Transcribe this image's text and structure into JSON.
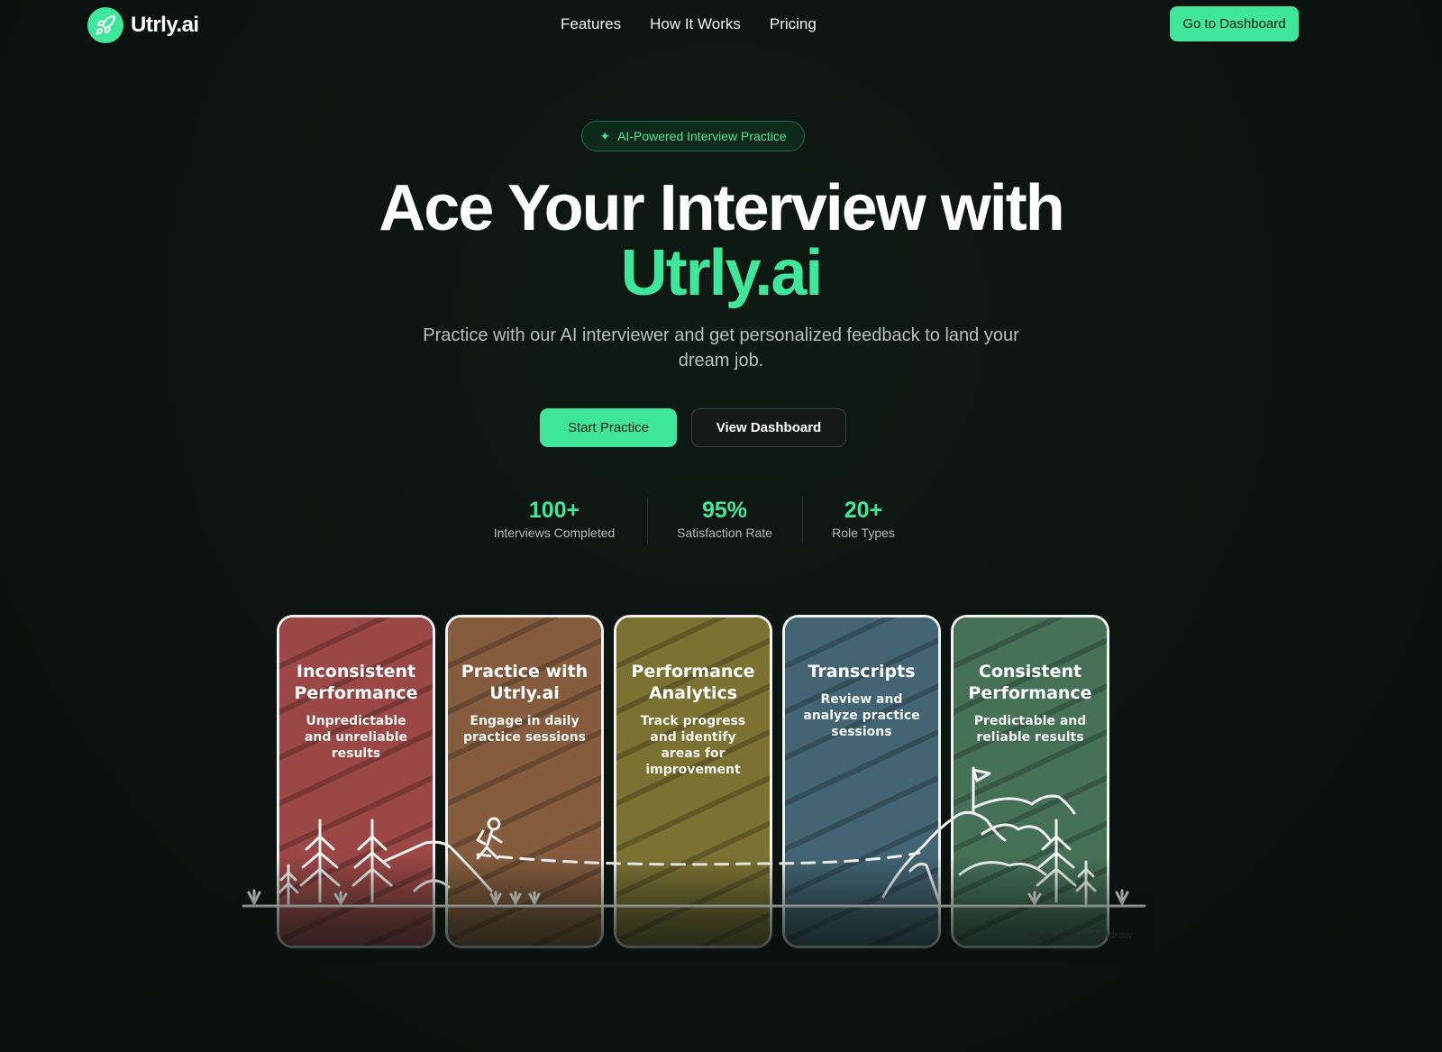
{
  "brand": {
    "name": "Utrly.ai",
    "accent": "#3fe79a"
  },
  "nav": {
    "links": [
      "Features",
      "How It Works",
      "Pricing"
    ],
    "cta_label": "Go to Dashboard"
  },
  "hero": {
    "badge": "AI-Powered Interview Practice",
    "title_line1": "Ace Your Interview with",
    "title_line2": "Utrly.ai",
    "subtitle": "Practice with our AI interviewer and get personalized feedback to land your dream job.",
    "primary_button": "Start Practice",
    "secondary_button": "View Dashboard"
  },
  "stats": [
    {
      "value": "100+",
      "label": "Interviews Completed"
    },
    {
      "value": "95%",
      "label": "Satisfaction Rate"
    },
    {
      "value": "20+",
      "label": "Role Types"
    }
  ],
  "journey": {
    "cards": [
      {
        "title": "Inconsistent Performance",
        "text": "Unpredictable and unreliable results",
        "color": "#9a4745"
      },
      {
        "title": "Practice with Utrly.ai",
        "text": "Engage in daily practice sessions",
        "color": "#855c3d"
      },
      {
        "title": "Performance Analytics",
        "text": "Track progress and identify areas for improvement",
        "color": "#7b7232"
      },
      {
        "title": "Transcripts",
        "text": "Review and analyze practice sessions",
        "color": "#426473"
      },
      {
        "title": "Consistent Performance",
        "text": "Predictable and reliable results",
        "color": "#457157"
      }
    ],
    "watermark": "Made with Excalidraw"
  }
}
